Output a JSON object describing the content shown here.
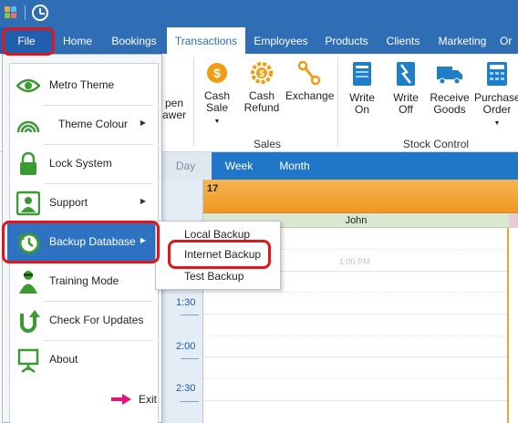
{
  "tabs": {
    "file": "File",
    "home": "Home",
    "bookings": "Bookings",
    "transactions": "Transactions",
    "employees": "Employees",
    "products": "Products",
    "clients": "Clients",
    "marketing": "Marketing",
    "overflow": "Or"
  },
  "ribbon": {
    "open_drawer_l1": "pen",
    "open_drawer_l2": "awer",
    "cash_sale_l1": "Cash",
    "cash_sale_l2": "Sale",
    "cash_refund_l1": "Cash",
    "cash_refund_l2": "Refund",
    "exchange": "Exchange",
    "write_on_l1": "Write",
    "write_on_l2": "On",
    "write_off_l1": "Write",
    "write_off_l2": "Off",
    "receive_goods_l1": "Receive",
    "receive_goods_l2": "Goods",
    "purchase_order_l1": "Purchase",
    "purchase_order_l2": "Order",
    "group_sales": "Sales",
    "group_stock": "Stock Control"
  },
  "calendar": {
    "views": {
      "day": "Day",
      "week": "Week",
      "month": "Month"
    },
    "date": "17",
    "resource": "John",
    "slot_100": "1:00 PM",
    "times": {
      "t130": "1:30",
      "t200": "2:00",
      "t230": "2:30"
    }
  },
  "file_menu": {
    "metro_theme": "Metro Theme",
    "theme_colour": "Theme Colour",
    "lock_system": "Lock System",
    "support": "Support",
    "backup_database": "Backup Database",
    "training_mode": "Training Mode",
    "check_updates": "Check For Updates",
    "about": "About",
    "exit": "Exit"
  },
  "backup_submenu": {
    "local": "Local Backup",
    "internet": "Internet Backup",
    "test": "Test Backup"
  },
  "colors": {
    "brand_blue": "#2f6db4",
    "highlight_blue": "#2e72c2",
    "calendar_orange": "#ee9820",
    "annotation_red": "#e0161c",
    "icon_green": "#3a9b34"
  }
}
